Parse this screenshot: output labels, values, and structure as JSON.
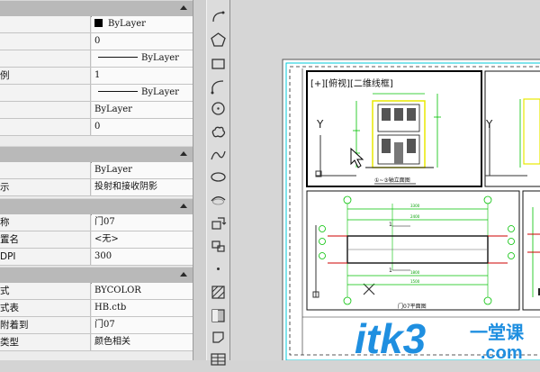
{
  "properties": {
    "sections": [
      {
        "name": "general",
        "rows": [
          {
            "label": "",
            "value": "ByLayer",
            "kind": "swatch"
          },
          {
            "label": "",
            "value": "0"
          },
          {
            "label": "",
            "value": "ByLayer",
            "kind": "linetype"
          },
          {
            "label": "例",
            "value": "1"
          },
          {
            "label": "",
            "value": "ByLayer",
            "kind": "linetype"
          },
          {
            "label": "",
            "value": "ByLayer"
          },
          {
            "label": "",
            "value": "0"
          }
        ]
      },
      {
        "name": "3d-visualization",
        "rows": [
          {
            "label": "",
            "value": "ByLayer"
          },
          {
            "label": "示",
            "value": "投射和接收阴影"
          }
        ]
      },
      {
        "name": "layout",
        "rows": [
          {
            "label": "称",
            "value": "门07"
          },
          {
            "label": "置名",
            "value": "<无>"
          },
          {
            "label": "DPI",
            "value": "300"
          }
        ]
      },
      {
        "name": "plot-style",
        "rows": [
          {
            "label": "式",
            "value": "BYCOLOR"
          },
          {
            "label": "式表",
            "value": "HB.ctb"
          },
          {
            "label": "附着到",
            "value": "门07"
          },
          {
            "label": "类型",
            "value": "颜色相关"
          }
        ]
      }
    ]
  },
  "toolbar": {
    "tools": [
      "arc-icon",
      "polygon-icon",
      "rectangle-icon",
      "spline-arc-icon",
      "circle-icon",
      "revision-cloud-icon",
      "spline-icon",
      "ellipse-icon",
      "ellipse-arc-icon",
      "insert-block-icon",
      "make-block-icon",
      "point-icon",
      "hatch-icon",
      "gradient-icon",
      "region-icon",
      "table-icon"
    ]
  },
  "drawing": {
    "viewport_label": "[+][俯视][二维线框]",
    "ucs_y": "Y",
    "ucs_x": "X",
    "view_title_1": "①~③轴立面图",
    "view_title_2": "门07平面图",
    "dims": [
      "3300",
      "2400",
      "1800",
      "1500",
      "900",
      "2700"
    ],
    "axis_numbers": [
      "1",
      "2",
      "3"
    ],
    "axis_letters": [
      "A",
      "B",
      "C",
      "D"
    ],
    "colors": {
      "frame": "#00c8d8",
      "dims": "#00c000",
      "highlight": "#e8e800",
      "hatch": "#cc0000"
    }
  },
  "watermark": {
    "text": "itk3",
    "suffix": "一堂课",
    "domain": ".com"
  }
}
